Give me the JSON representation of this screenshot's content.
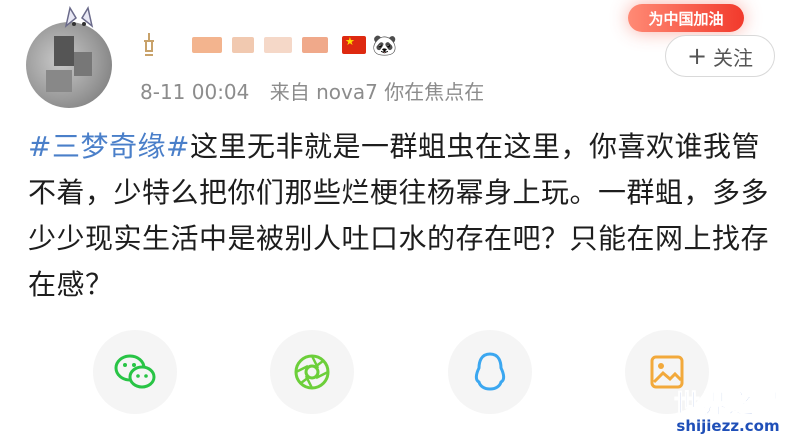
{
  "header": {
    "promo_badge": "为中国加油",
    "follow_label": "关注",
    "meta": {
      "time": "8-11 00:04",
      "source": "来自 nova7 你在焦点在"
    }
  },
  "post": {
    "topic": "#三梦奇缘#",
    "text": "这里无非就是一群蛆虫在这里，你喜欢谁我管不着，少特么把你们那些烂梗往杨幂身上玩。一群蛆，多多少少现实生活中是被别人吐口水的存在吧？只能在网上找存在感？"
  },
  "share": [
    {
      "name": "wechat",
      "icon": "wechat-icon"
    },
    {
      "name": "moments",
      "icon": "camera-aperture-icon"
    },
    {
      "name": "qq",
      "icon": "qq-penguin-icon"
    },
    {
      "name": "image",
      "icon": "image-icon"
    }
  ],
  "watermark": {
    "main": "世界之最",
    "sub": "shijiezz.com"
  },
  "colors": {
    "topic": "#4a7fc9",
    "wechat": "#28c445",
    "moments": "#6ccf3a",
    "qq": "#3ba7f0",
    "image": "#f2a93b"
  }
}
